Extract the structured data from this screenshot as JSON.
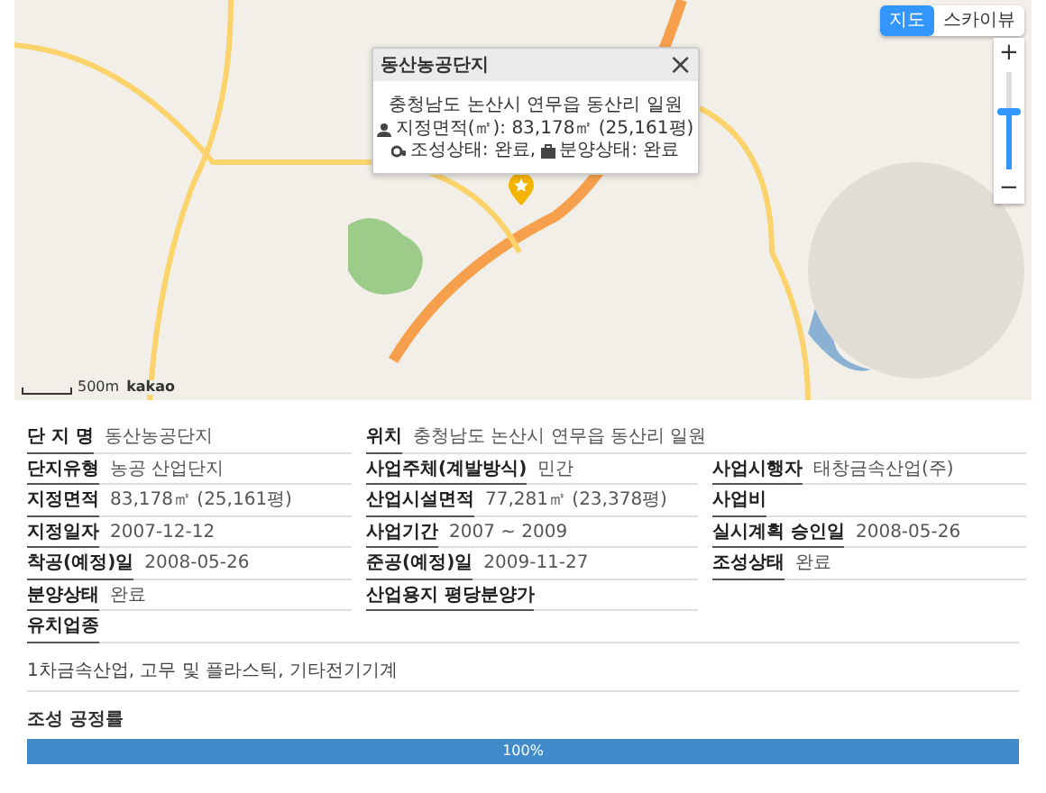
{
  "map": {
    "type_buttons": [
      {
        "label": "지도",
        "selected": true
      },
      {
        "label": "스카이뷰",
        "selected": false
      }
    ],
    "zoom": {
      "in": "+",
      "out": "−",
      "level": 0.6
    },
    "popup": {
      "title": "동산농공단지",
      "close": "×",
      "address": "충청남도 논산시 연무읍 동산리 일원",
      "lines": [
        [
          {
            "kind": "area",
            "text": "지정면적(㎡):  83,178㎡ (25,161평)"
          }
        ],
        [
          {
            "kind": "gears",
            "text": "조성상태:  완료,"
          },
          {
            "kind": "bag",
            "text": "분양상태:  완료"
          }
        ]
      ]
    },
    "scale": "500m",
    "logo": "kakao"
  },
  "info_rows": [
    [
      {
        "label": "단 지 명",
        "value": "동산농공단지"
      },
      {
        "label": "위치",
        "value": "충청남도 논산시 연무읍 동산리 일원"
      }
    ],
    [
      {
        "label": "단지유형",
        "value": "농공 산업단지"
      },
      {
        "label": "사업주체(계발방식)",
        "value": "민간"
      },
      {
        "label": "사업시행자",
        "value": "태창금속산업(주)"
      }
    ],
    [
      {
        "label": "지정면적",
        "value": "83,178㎡ (25,161평)"
      },
      {
        "label": "산업시설면적",
        "value": "77,281㎡ (23,378평)"
      },
      {
        "label": "사업비"
      }
    ],
    [
      {
        "label": "지정일자",
        "value": "2007-12-12"
      },
      {
        "label": "사업기간",
        "value": "2007 ~ 2009"
      },
      {
        "label": "실시계획 승인일",
        "value": "2008-05-26"
      }
    ],
    [
      {
        "label": "착공(예정)일",
        "value": "2008-05-26"
      },
      {
        "label": "준공(예정)일",
        "value": "2009-11-27"
      },
      {
        "label": "조성상태",
        "value": "완료"
      }
    ],
    [
      {
        "label": "분양상태",
        "value": "완료"
      },
      {
        "label": "산업용지 평당분양가"
      },
      null
    ]
  ],
  "industries": {
    "label": "유치업종",
    "value": "1차금속산업, 고무 및 플라스틱, 기타전기기계"
  },
  "progress": {
    "label": "조성 공정률",
    "level": 1,
    "text": "100%"
  }
}
